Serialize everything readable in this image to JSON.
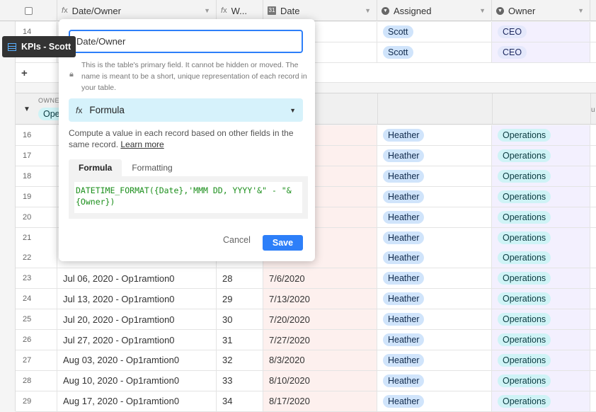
{
  "header": {
    "date_owner": "Date/Owner",
    "w": "W...",
    "date": "Date",
    "assigned": "Assigned",
    "owner": "Owner"
  },
  "table_chip": "KPIs - Scott",
  "top_rows": [
    {
      "num": "14",
      "assigned": "Scott",
      "owner": "CEO"
    },
    {
      "num": "",
      "assigned": "Scott",
      "owner": "CEO"
    }
  ],
  "add_symbol": "+",
  "group": {
    "label": "OWNER",
    "value": "Ope",
    "side_text": "u"
  },
  "rows": [
    {
      "num": "16",
      "name": "",
      "w": "",
      "date": "",
      "assigned": "Heather",
      "owner": "Operations"
    },
    {
      "num": "17",
      "name": "",
      "w": "",
      "date": "",
      "assigned": "Heather",
      "owner": "Operations"
    },
    {
      "num": "18",
      "name": "",
      "w": "",
      "date": "",
      "assigned": "Heather",
      "owner": "Operations"
    },
    {
      "num": "19",
      "name": "",
      "w": "",
      "date": "",
      "assigned": "Heather",
      "owner": "Operations"
    },
    {
      "num": "20",
      "name": "",
      "w": "",
      "date": "",
      "assigned": "Heather",
      "owner": "Operations"
    },
    {
      "num": "21",
      "name": "",
      "w": "",
      "date": "",
      "assigned": "Heather",
      "owner": "Operations"
    },
    {
      "num": "22",
      "name": "",
      "w": "",
      "date": "",
      "assigned": "Heather",
      "owner": "Operations"
    },
    {
      "num": "23",
      "name": "Jul 06, 2020 - Op1ramtion0",
      "w": "28",
      "date": "7/6/2020",
      "assigned": "Heather",
      "owner": "Operations"
    },
    {
      "num": "24",
      "name": "Jul 13, 2020 - Op1ramtion0",
      "w": "29",
      "date": "7/13/2020",
      "assigned": "Heather",
      "owner": "Operations"
    },
    {
      "num": "25",
      "name": "Jul 20, 2020 - Op1ramtion0",
      "w": "30",
      "date": "7/20/2020",
      "assigned": "Heather",
      "owner": "Operations"
    },
    {
      "num": "26",
      "name": "Jul 27, 2020 - Op1ramtion0",
      "w": "31",
      "date": "7/27/2020",
      "assigned": "Heather",
      "owner": "Operations"
    },
    {
      "num": "27",
      "name": "Aug 03, 2020 - Op1ramtion0",
      "w": "32",
      "date": "8/3/2020",
      "assigned": "Heather",
      "owner": "Operations"
    },
    {
      "num": "28",
      "name": "Aug 10, 2020 - Op1ramtion0",
      "w": "33",
      "date": "8/10/2020",
      "assigned": "Heather",
      "owner": "Operations"
    },
    {
      "num": "29",
      "name": "Aug 17, 2020 - Op1ramtion0",
      "w": "34",
      "date": "8/17/2020",
      "assigned": "Heather",
      "owner": "Operations"
    }
  ],
  "popup": {
    "field_name": "Date/Owner",
    "note": "This is the table's primary field. It cannot be hidden or moved. The name is meant to be a short, unique representation of each record in your table.",
    "type_label": "Formula",
    "desc_text": "Compute a value in each record based on other fields in the same record. ",
    "learn_more": "Learn more",
    "tab_formula": "Formula",
    "tab_formatting": "Formatting",
    "formula_line1": "DATETIME_FORMAT({Date},'MMM DD, YYYY'&\" - \"&",
    "formula_line2": "{Owner})",
    "cancel": "Cancel",
    "save": "Save"
  },
  "colors": {
    "accent": "#2d7ff9",
    "formula_green": "#1c8f1c",
    "type_bg": "#d6f2fb"
  }
}
